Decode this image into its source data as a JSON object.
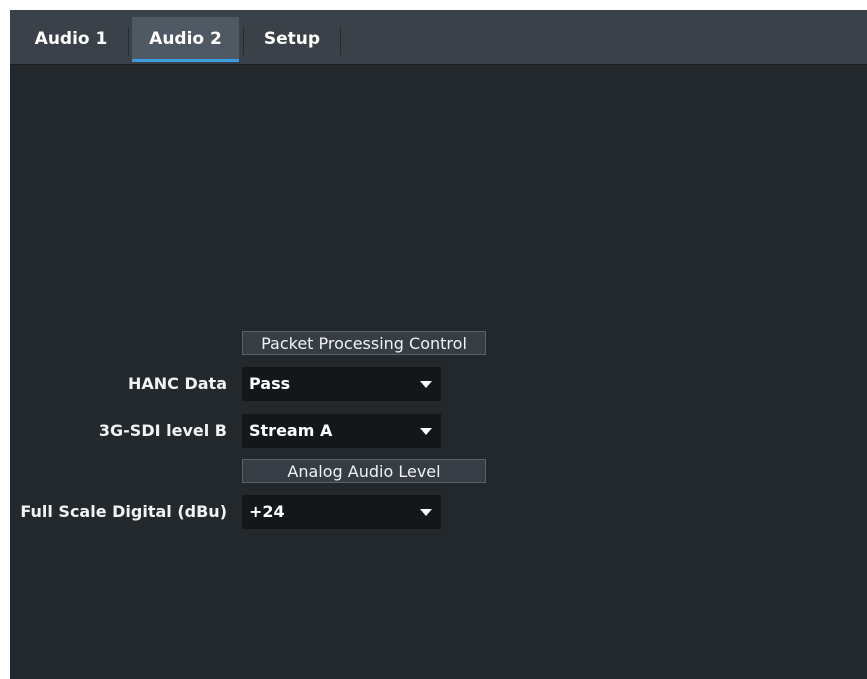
{
  "tabs": [
    {
      "label": "Audio 1",
      "active": false
    },
    {
      "label": "Audio 2",
      "active": true
    },
    {
      "label": "Setup",
      "active": false
    }
  ],
  "colors": {
    "background": "#23282c",
    "tabbar": "#3b4148",
    "active_tab": "#4f5963",
    "active_indicator": "#3b9ddd",
    "dropdown_bg": "#14171a"
  },
  "sections": {
    "packet_processing": {
      "header": "Packet Processing Control",
      "hanc_data": {
        "label": "HANC Data",
        "value": "Pass"
      },
      "sdi_level_b": {
        "label": "3G-SDI level B",
        "value": "Stream A"
      }
    },
    "analog_audio": {
      "header": "Analog Audio Level",
      "full_scale": {
        "label": "Full Scale Digital (dBu)",
        "value": "+24"
      }
    }
  }
}
